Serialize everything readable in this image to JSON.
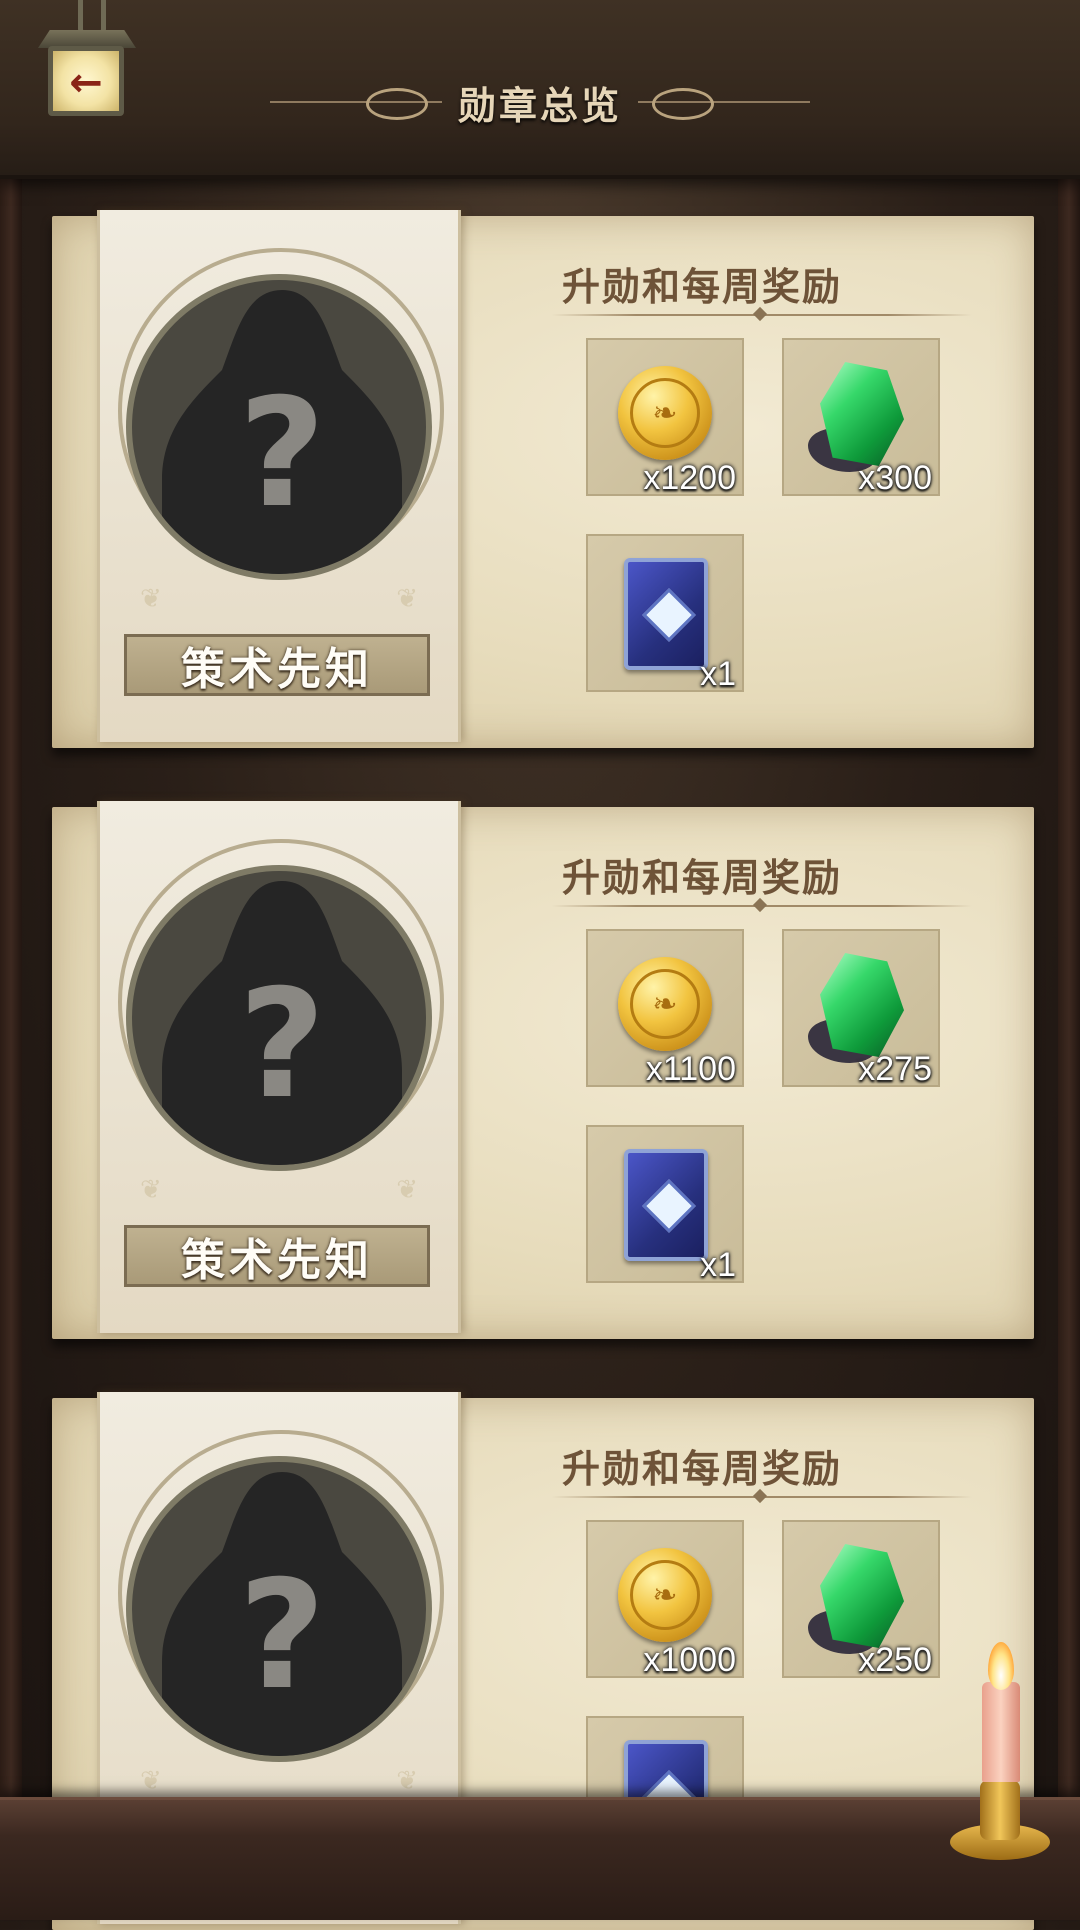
{
  "header": {
    "title": "勋章总览",
    "back_icon": "back-arrow-icon"
  },
  "cards": [
    {
      "badge_name": "策术先知",
      "reward_title": "升勋和每周奖励",
      "rewards": [
        {
          "icon": "gold-coin-icon",
          "qty": "x1200"
        },
        {
          "icon": "green-gem-icon",
          "qty": "x300"
        },
        {
          "icon": "card-back-icon",
          "qty": "x1"
        }
      ]
    },
    {
      "badge_name": "策术先知",
      "reward_title": "升勋和每周奖励",
      "rewards": [
        {
          "icon": "gold-coin-icon",
          "qty": "x1100"
        },
        {
          "icon": "green-gem-icon",
          "qty": "x275"
        },
        {
          "icon": "card-back-icon",
          "qty": "x1"
        }
      ]
    },
    {
      "badge_name": "",
      "reward_title": "升勋和每周奖励",
      "rewards": [
        {
          "icon": "gold-coin-icon",
          "qty": "x1000"
        },
        {
          "icon": "green-gem-icon",
          "qty": "x250"
        },
        {
          "icon": "card-back-icon",
          "qty": ""
        }
      ]
    }
  ],
  "colors": {
    "title_text": "#e6d6b8",
    "reward_title_text": "#6e5338",
    "parchment": "#e7dcbc"
  }
}
